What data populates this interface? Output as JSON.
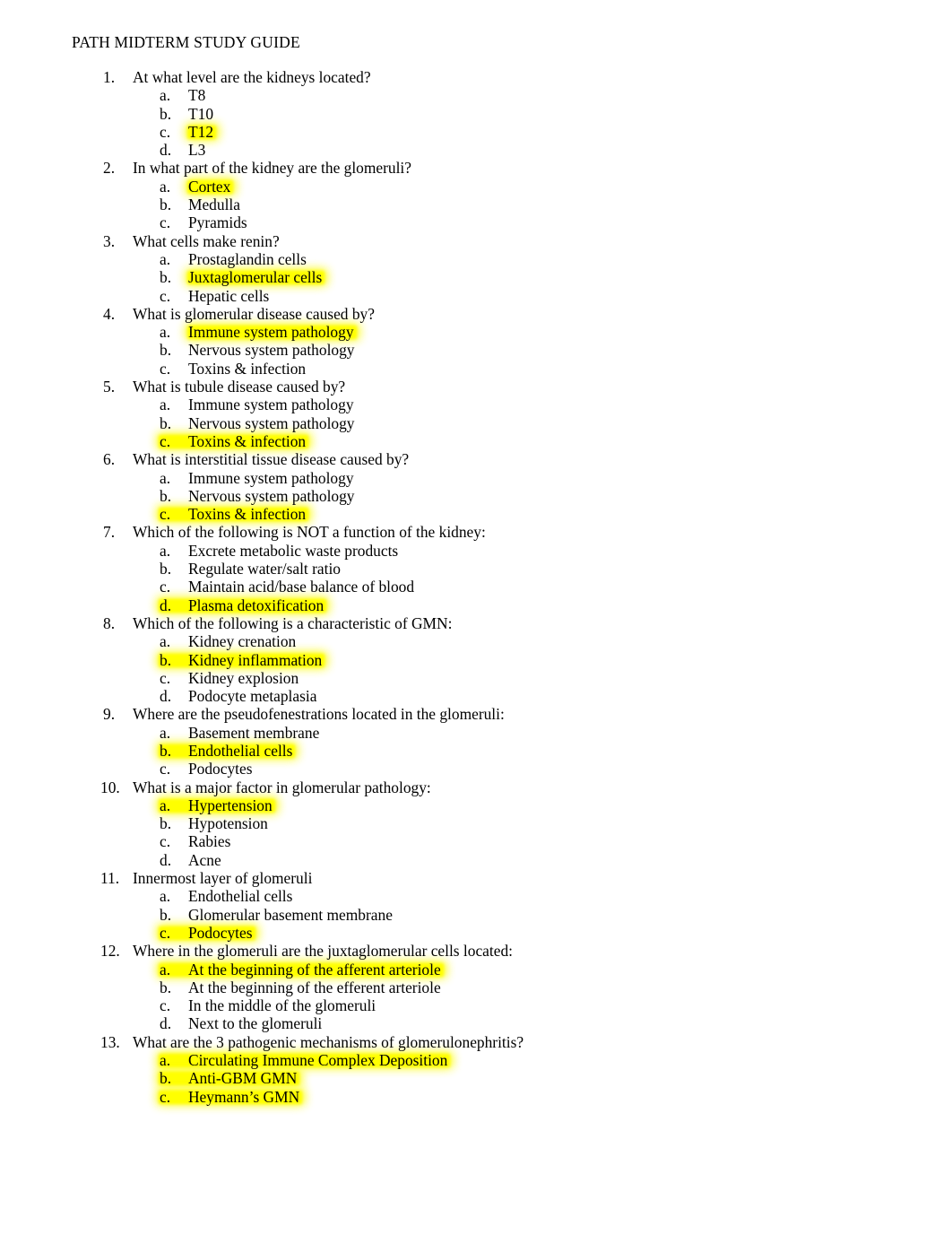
{
  "document": {
    "title": "PATH MIDTERM STUDY GUIDE",
    "highlight_color": "#ffff00",
    "page_background": "#ffffff",
    "text_color": "#000000"
  },
  "questions": [
    {
      "number": "1.",
      "text": "At what level are the kidneys located?",
      "options": [
        {
          "letter": "a.",
          "text": "T8",
          "highlighted": false,
          "highlight_includes_letter": false
        },
        {
          "letter": "b.",
          "text": "T10",
          "highlighted": false,
          "highlight_includes_letter": false
        },
        {
          "letter": "c.",
          "text": "T12",
          "highlighted": true,
          "highlight_includes_letter": false
        },
        {
          "letter": "d.",
          "text": "L3",
          "highlighted": false,
          "highlight_includes_letter": false
        }
      ]
    },
    {
      "number": "2.",
      "text": "In what part of the kidney are the glomeruli?",
      "options": [
        {
          "letter": "a.",
          "text": "Cortex",
          "highlighted": true,
          "highlight_includes_letter": false
        },
        {
          "letter": "b.",
          "text": "Medulla",
          "highlighted": false,
          "highlight_includes_letter": false
        },
        {
          "letter": "c.",
          "text": "Pyramids",
          "highlighted": false,
          "highlight_includes_letter": false
        }
      ]
    },
    {
      "number": "3.",
      "text": "What cells make renin?",
      "options": [
        {
          "letter": "a.",
          "text": "Prostaglandin cells",
          "highlighted": false,
          "highlight_includes_letter": false
        },
        {
          "letter": "b.",
          "text": "Juxtaglomerular cells",
          "highlighted": true,
          "highlight_includes_letter": false
        },
        {
          "letter": "c.",
          "text": "Hepatic cells",
          "highlighted": false,
          "highlight_includes_letter": false
        }
      ]
    },
    {
      "number": "4.",
      "text": "What is glomerular disease caused by?",
      "options": [
        {
          "letter": "a.",
          "text": "Immune system pathology",
          "highlighted": true,
          "highlight_includes_letter": false
        },
        {
          "letter": "b.",
          "text": "Nervous system pathology",
          "highlighted": false,
          "highlight_includes_letter": false
        },
        {
          "letter": "c.",
          "text": "Toxins & infection",
          "highlighted": false,
          "highlight_includes_letter": false
        }
      ]
    },
    {
      "number": "5.",
      "text": "What is tubule disease caused by?",
      "options": [
        {
          "letter": "a.",
          "text": "Immune system pathology",
          "highlighted": false,
          "highlight_includes_letter": false
        },
        {
          "letter": "b.",
          "text": "Nervous system pathology",
          "highlighted": false,
          "highlight_includes_letter": false
        },
        {
          "letter": "c.",
          "text": "Toxins & infection",
          "highlighted": true,
          "highlight_includes_letter": true
        }
      ]
    },
    {
      "number": "6.",
      "text": "What is interstitial tissue disease caused by?",
      "options": [
        {
          "letter": "a.",
          "text": "Immune system pathology",
          "highlighted": false,
          "highlight_includes_letter": false
        },
        {
          "letter": "b.",
          "text": "Nervous system pathology",
          "highlighted": false,
          "highlight_includes_letter": false
        },
        {
          "letter": "c.",
          "text": "Toxins & infection",
          "highlighted": true,
          "highlight_includes_letter": true
        }
      ]
    },
    {
      "number": "7.",
      "text": "Which of the following is NOT a function of the kidney:",
      "options": [
        {
          "letter": "a.",
          "text": "Excrete metabolic waste products",
          "highlighted": false,
          "highlight_includes_letter": false
        },
        {
          "letter": "b.",
          "text": "Regulate water/salt ratio",
          "highlighted": false,
          "highlight_includes_letter": false
        },
        {
          "letter": "c.",
          "text": "Maintain acid/base balance of blood",
          "highlighted": false,
          "highlight_includes_letter": false
        },
        {
          "letter": "d.",
          "text": "Plasma detoxification",
          "highlighted": true,
          "highlight_includes_letter": true
        }
      ]
    },
    {
      "number": "8.",
      "text": "Which of the following is a characteristic of GMN:",
      "options": [
        {
          "letter": "a.",
          "text": "Kidney crenation",
          "highlighted": false,
          "highlight_includes_letter": false
        },
        {
          "letter": "b.",
          "text": "Kidney inflammation",
          "highlighted": true,
          "highlight_includes_letter": true
        },
        {
          "letter": "c.",
          "text": "Kidney explosion",
          "highlighted": false,
          "highlight_includes_letter": false
        },
        {
          "letter": "d.",
          "text": "Podocyte metaplasia",
          "highlighted": false,
          "highlight_includes_letter": false
        }
      ]
    },
    {
      "number": "9.",
      "text": "Where are the pseudofenestrations located in the glomeruli:",
      "options": [
        {
          "letter": "a.",
          "text": "Basement membrane",
          "highlighted": false,
          "highlight_includes_letter": false
        },
        {
          "letter": "b.",
          "text": "Endothelial cells",
          "highlighted": true,
          "highlight_includes_letter": true
        },
        {
          "letter": "c.",
          "text": "Podocytes",
          "highlighted": false,
          "highlight_includes_letter": false
        }
      ]
    },
    {
      "number": "10.",
      "text": "What is a major factor in glomerular pathology:",
      "options": [
        {
          "letter": "a.",
          "text": "Hypertension",
          "highlighted": true,
          "highlight_includes_letter": true
        },
        {
          "letter": "b.",
          "text": "Hypotension",
          "highlighted": false,
          "highlight_includes_letter": false
        },
        {
          "letter": "c.",
          "text": "Rabies",
          "highlighted": false,
          "highlight_includes_letter": false
        },
        {
          "letter": "d.",
          "text": "Acne",
          "highlighted": false,
          "highlight_includes_letter": false
        }
      ]
    },
    {
      "number": "11.",
      "text": "Innermost layer of glomeruli",
      "options": [
        {
          "letter": "a.",
          "text": "Endothelial cells",
          "highlighted": false,
          "highlight_includes_letter": false
        },
        {
          "letter": "b.",
          "text": "Glomerular basement membrane",
          "highlighted": false,
          "highlight_includes_letter": false
        },
        {
          "letter": "c.",
          "text": "Podocytes",
          "highlighted": true,
          "highlight_includes_letter": true
        }
      ]
    },
    {
      "number": "12.",
      "text": "Where in the glomeruli are the juxtaglomerular cells located:",
      "options": [
        {
          "letter": "a.",
          "text": "At the beginning of the afferent arteriole",
          "highlighted": true,
          "highlight_includes_letter": true
        },
        {
          "letter": "b.",
          "text": "At the beginning of the efferent arteriole",
          "highlighted": false,
          "highlight_includes_letter": false
        },
        {
          "letter": "c.",
          "text": "In the middle of the glomeruli",
          "highlighted": false,
          "highlight_includes_letter": false
        },
        {
          "letter": "d.",
          "text": "Next to the glomeruli",
          "highlighted": false,
          "highlight_includes_letter": false
        }
      ]
    },
    {
      "number": "13.",
      "text": "What are the 3 pathogenic mechanisms of glomerulonephritis?",
      "options": [
        {
          "letter": "a.",
          "text": "Circulating Immune Complex Deposition",
          "highlighted": true,
          "highlight_includes_letter": true
        },
        {
          "letter": "b.",
          "text": "Anti-GBM GMN",
          "highlighted": true,
          "highlight_includes_letter": true
        },
        {
          "letter": "c.",
          "text": "Heymann’s GMN",
          "highlighted": true,
          "highlight_includes_letter": true
        }
      ]
    }
  ]
}
